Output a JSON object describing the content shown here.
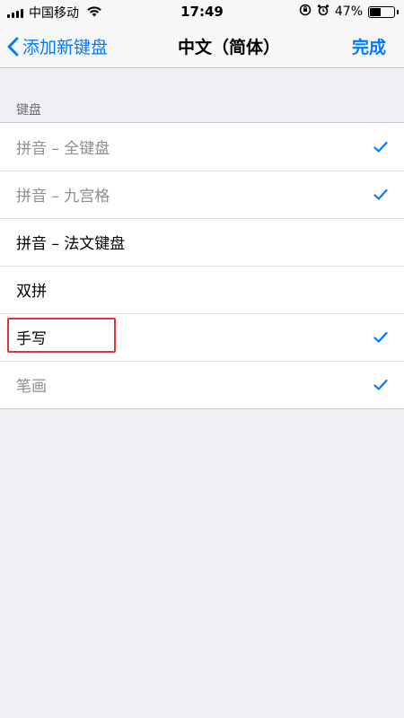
{
  "status_bar": {
    "carrier": "中国移动",
    "time": "17:49",
    "battery_percent": "47%",
    "battery_level": 0.47
  },
  "nav": {
    "back_label": "添加新键盘",
    "title": "中文（简体）",
    "done_label": "完成"
  },
  "section": {
    "header": "键盘"
  },
  "keyboards": [
    {
      "label": "拼音 – 全键盘",
      "checked": true,
      "disabled": true
    },
    {
      "label": "拼音 – 九宫格",
      "checked": true,
      "disabled": true
    },
    {
      "label": "拼音 – 法文键盘",
      "checked": false,
      "disabled": false
    },
    {
      "label": "双拼",
      "checked": false,
      "disabled": false
    },
    {
      "label": "手写",
      "checked": true,
      "disabled": false,
      "highlighted": true
    },
    {
      "label": "笔画",
      "checked": true,
      "disabled": true
    }
  ],
  "colors": {
    "accent": "#007aff",
    "highlight": "#e0343a"
  }
}
